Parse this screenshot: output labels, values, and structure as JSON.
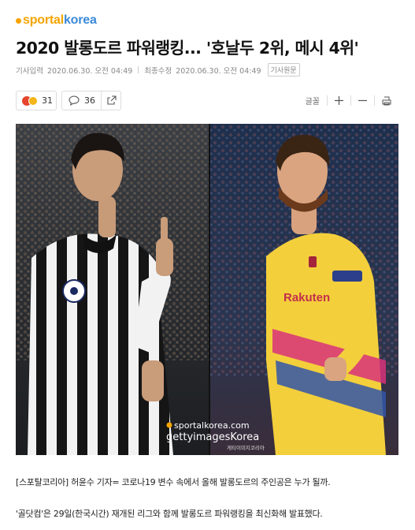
{
  "site": {
    "logo_part1": "sportal",
    "logo_part2": "korea"
  },
  "article": {
    "title": "2020 발롱도르 파워랭킹... '호날두 2위, 메시 4위'",
    "published_label": "기사입력",
    "published_value": "2020.06.30. 오전 04:49",
    "updated_label": "최종수정",
    "updated_value": "2020.06.30. 오전 04:49",
    "original_link": "기사원문",
    "paragraph1": "[스포탈코리아] 허윤수 기자= 코로나19 변수 속에서 올해 발롱도르의 주인공은 누가 될까.",
    "paragraph2": "'골닷컴'은 29일(한국시간) 재개된 리그와 함께 발롱도르 파워랭킹을 최신화해 발표했다."
  },
  "toolbar": {
    "reaction_count": "31",
    "comment_count": "36",
    "font_label": "글꼴"
  },
  "photo": {
    "watermark_site": "sportalkorea.com",
    "watermark_agency": "gettyimagesKorea",
    "watermark_small": "게티이미지코리아",
    "shirt_word": "Rakuten"
  },
  "colors": {
    "logo_orange": "#f5a400",
    "logo_blue": "#3a8ad9",
    "reaction_red": "#e6452d"
  }
}
